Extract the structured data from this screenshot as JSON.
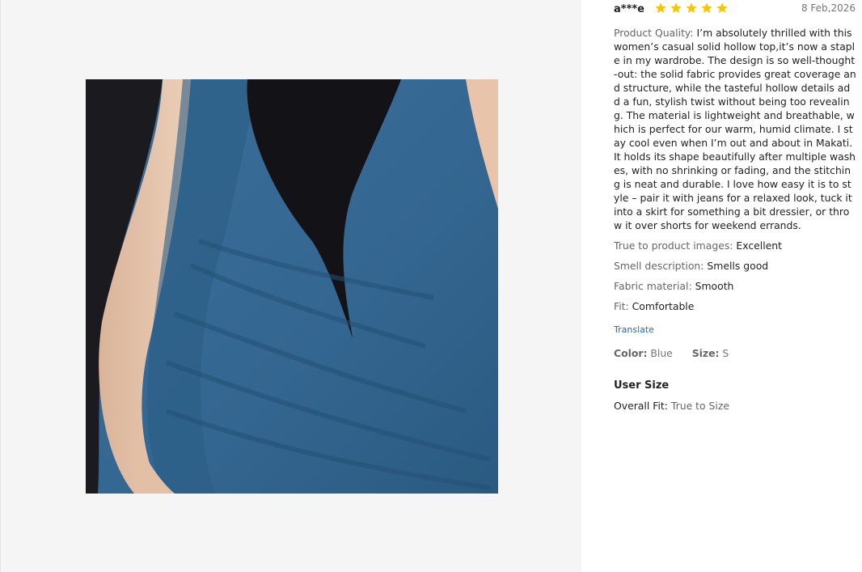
{
  "colors": {
    "star": "#f7c600",
    "link": "#2b6aa8",
    "pane_bg": "#f5f5f5"
  },
  "review": {
    "user": "a***e",
    "rating": 5,
    "date": "8 Feb,2026",
    "quality_label": "Product Quality:",
    "quality_text": "I’m absolutely thrilled with this women’s casual solid hollow top,it’s now a staple in my wardrobe. The design is so well-thought-out: the solid fabric provides great coverage and structure, while the tasteful hollow details add a fun, stylish twist without being too revealing. The material is lightweight and breathable, which is perfect for our warm, humid climate. I stay cool even when I’m out and about in Makati. It holds its shape beautifully after multiple washes, with no shrinking or fading, and the stitching is neat and durable. I love how easy it is to style – pair it with jeans for a relaxed look, tuck it into a skirt for something a bit dressier, or throw it over shorts for weekend errands.",
    "attributes": [
      {
        "label": "True to product images:",
        "value": "Excellent"
      },
      {
        "label": "Smell description:",
        "value": "Smells good"
      },
      {
        "label": "Fabric material:",
        "value": "Smooth"
      },
      {
        "label": "Fit:",
        "value": "Comfortable"
      }
    ],
    "translate_label": "Translate",
    "color_label": "Color:",
    "color_value": "Blue",
    "size_label": "Size:",
    "size_value": "S",
    "user_size_title": "User Size",
    "overall_fit_label": "Overall Fit:",
    "overall_fit_value": "True to Size"
  },
  "photo": {
    "icon": "review-photo"
  }
}
